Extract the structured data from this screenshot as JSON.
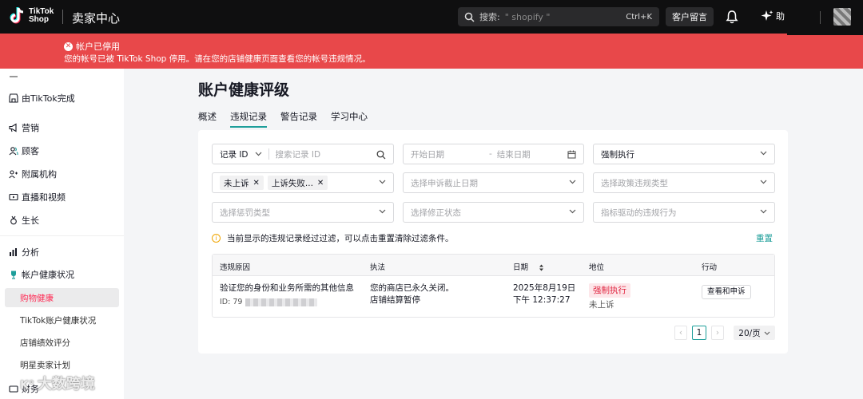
{
  "topbar": {
    "logo_line1": "TikTok",
    "logo_line2": "Shop",
    "brand": "卖家中心",
    "search_label": "搜索:",
    "search_placeholder": "\" shopify \"",
    "search_shortcut": "Ctrl+K",
    "customer_message": "客户留言",
    "assistant_label": "助",
    "icons": [
      "tiktok-logo-icon",
      "search-icon",
      "bell-icon",
      "sparkle-icon"
    ]
  },
  "banner": {
    "title": "帐户已停用",
    "description": "您的帐号已被 TikTok Shop 停用。请在您的店铺健康页面查看您的帐号违规情况。",
    "color": "#e8484a"
  },
  "sidebar": {
    "items": [
      {
        "label": "由TikTok完成",
        "icon": "store-icon"
      },
      {
        "label": "营销",
        "icon": "megaphone-icon"
      },
      {
        "label": "顾客",
        "icon": "customers-icon"
      },
      {
        "label": "附属机构",
        "icon": "affiliate-icon"
      },
      {
        "label": "直播和视频",
        "icon": "video-icon"
      },
      {
        "label": "生长",
        "icon": "growth-icon"
      },
      {
        "label": "分析",
        "icon": "chart-icon"
      },
      {
        "label": "帐户健康状况",
        "icon": "trophy-icon"
      }
    ],
    "sub_items": [
      "购物健康",
      "TikTok账户健康状况",
      "店铺绩效评分",
      "明星卖家计划"
    ],
    "active_sub": "购物健康",
    "watermark": "大数跨境",
    "clipped_bottom": "财务"
  },
  "main": {
    "title": "账户健康评级",
    "tabs": [
      {
        "label": "概述",
        "active": false
      },
      {
        "label": "违规记录",
        "active": true
      },
      {
        "label": "警告记录",
        "active": false
      },
      {
        "label": "学习中心",
        "active": false
      }
    ],
    "filters": {
      "record_select": "记录 ID",
      "record_placeholder": "搜索记录 ID",
      "start_date": "开始日期",
      "date_sep": "-",
      "end_date": "结束日期",
      "enforcement_select": "强制执行",
      "appeal_tags": [
        "未上诉",
        "上诉失败..."
      ],
      "appeal_deadline": "选择申诉截止日期",
      "policy_type": "选择政策违规类型",
      "penalty_type": "选择惩罚类型",
      "correction_status": "选择修正状态",
      "metric_behavior": "指标驱动的违规行为"
    },
    "notice": "当前显示的违规记录经过过滤，可以点击重置清除过滤条件。",
    "reset": "重置",
    "table": {
      "headers": [
        "违规原因",
        "执法",
        "日期",
        "地位",
        "行动"
      ],
      "rows": [
        {
          "reason": "验证您的身份和业务所需的其他信息",
          "id_label": "ID:",
          "id_value": "79",
          "enforcement_line1": "您的商店已永久关闭。",
          "enforcement_line2": "店铺结算暂停",
          "date_line1": "2025年8月19日",
          "date_line2": "下午 12:37:27",
          "status_badge": "强制执行",
          "status_sub": "未上诉",
          "action": "查看和申诉"
        }
      ]
    },
    "pagination": {
      "current": "1",
      "page_size": "20/页"
    }
  }
}
